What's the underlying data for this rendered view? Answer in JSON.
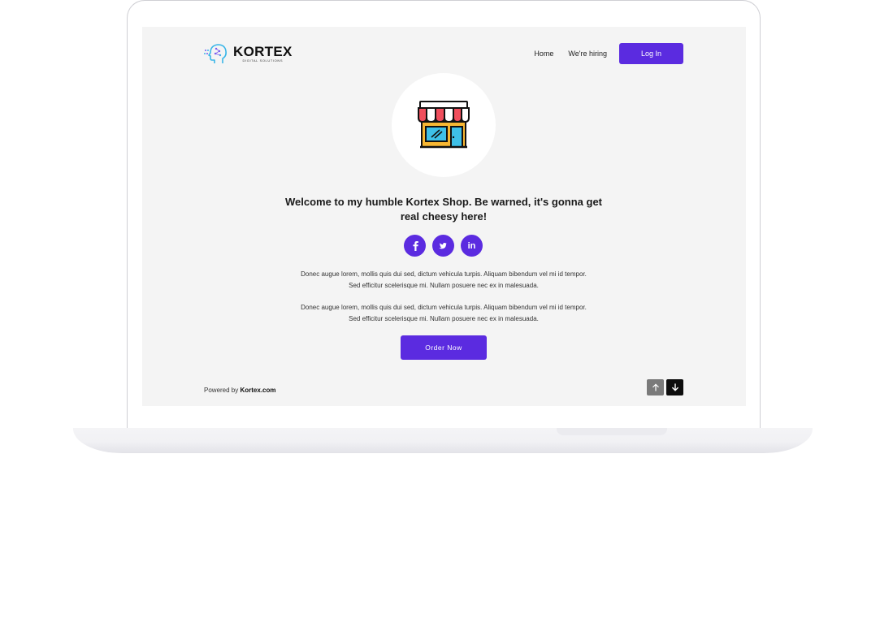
{
  "brand": {
    "name": "KORTEX",
    "tagline": "DIGITAL SOLUTIONS"
  },
  "nav": {
    "home_label": "Home",
    "hiring_label": "We're hiring",
    "login_label": "Log In"
  },
  "hero": {
    "icon": "storefront-icon",
    "headline": "Welcome to my humble Kortex Shop. Be warned, it's gonna get real cheesy here!",
    "socials": [
      {
        "name": "facebook-icon",
        "glyph": "f"
      },
      {
        "name": "twitter-icon",
        "glyph": "twitter"
      },
      {
        "name": "linkedin-icon",
        "glyph": "in"
      }
    ],
    "paragraphs": [
      "Donec augue lorem, mollis quis dui sed, dictum vehicula turpis. Aliquam bibendum vel mi id tempor. Sed efficitur scelerisque mi. Nullam posuere nec ex in malesuada.",
      "Donec augue lorem, mollis quis dui sed, dictum vehicula turpis. Aliquam bibendum vel mi id tempor. Sed efficitur scelerisque mi. Nullam posuere nec ex in malesuada."
    ],
    "cta_label": "Order Now"
  },
  "footer": {
    "powered_prefix": "Powered by",
    "powered_site": "Kortex.com",
    "scroll_up_icon": "arrow-up-icon",
    "scroll_down_icon": "arrow-down-icon"
  },
  "colors": {
    "accent": "#5b2be0",
    "screen_bg": "#f4f4f4",
    "up_button": "#7a7a7a",
    "down_button": "#0d0d0d"
  }
}
